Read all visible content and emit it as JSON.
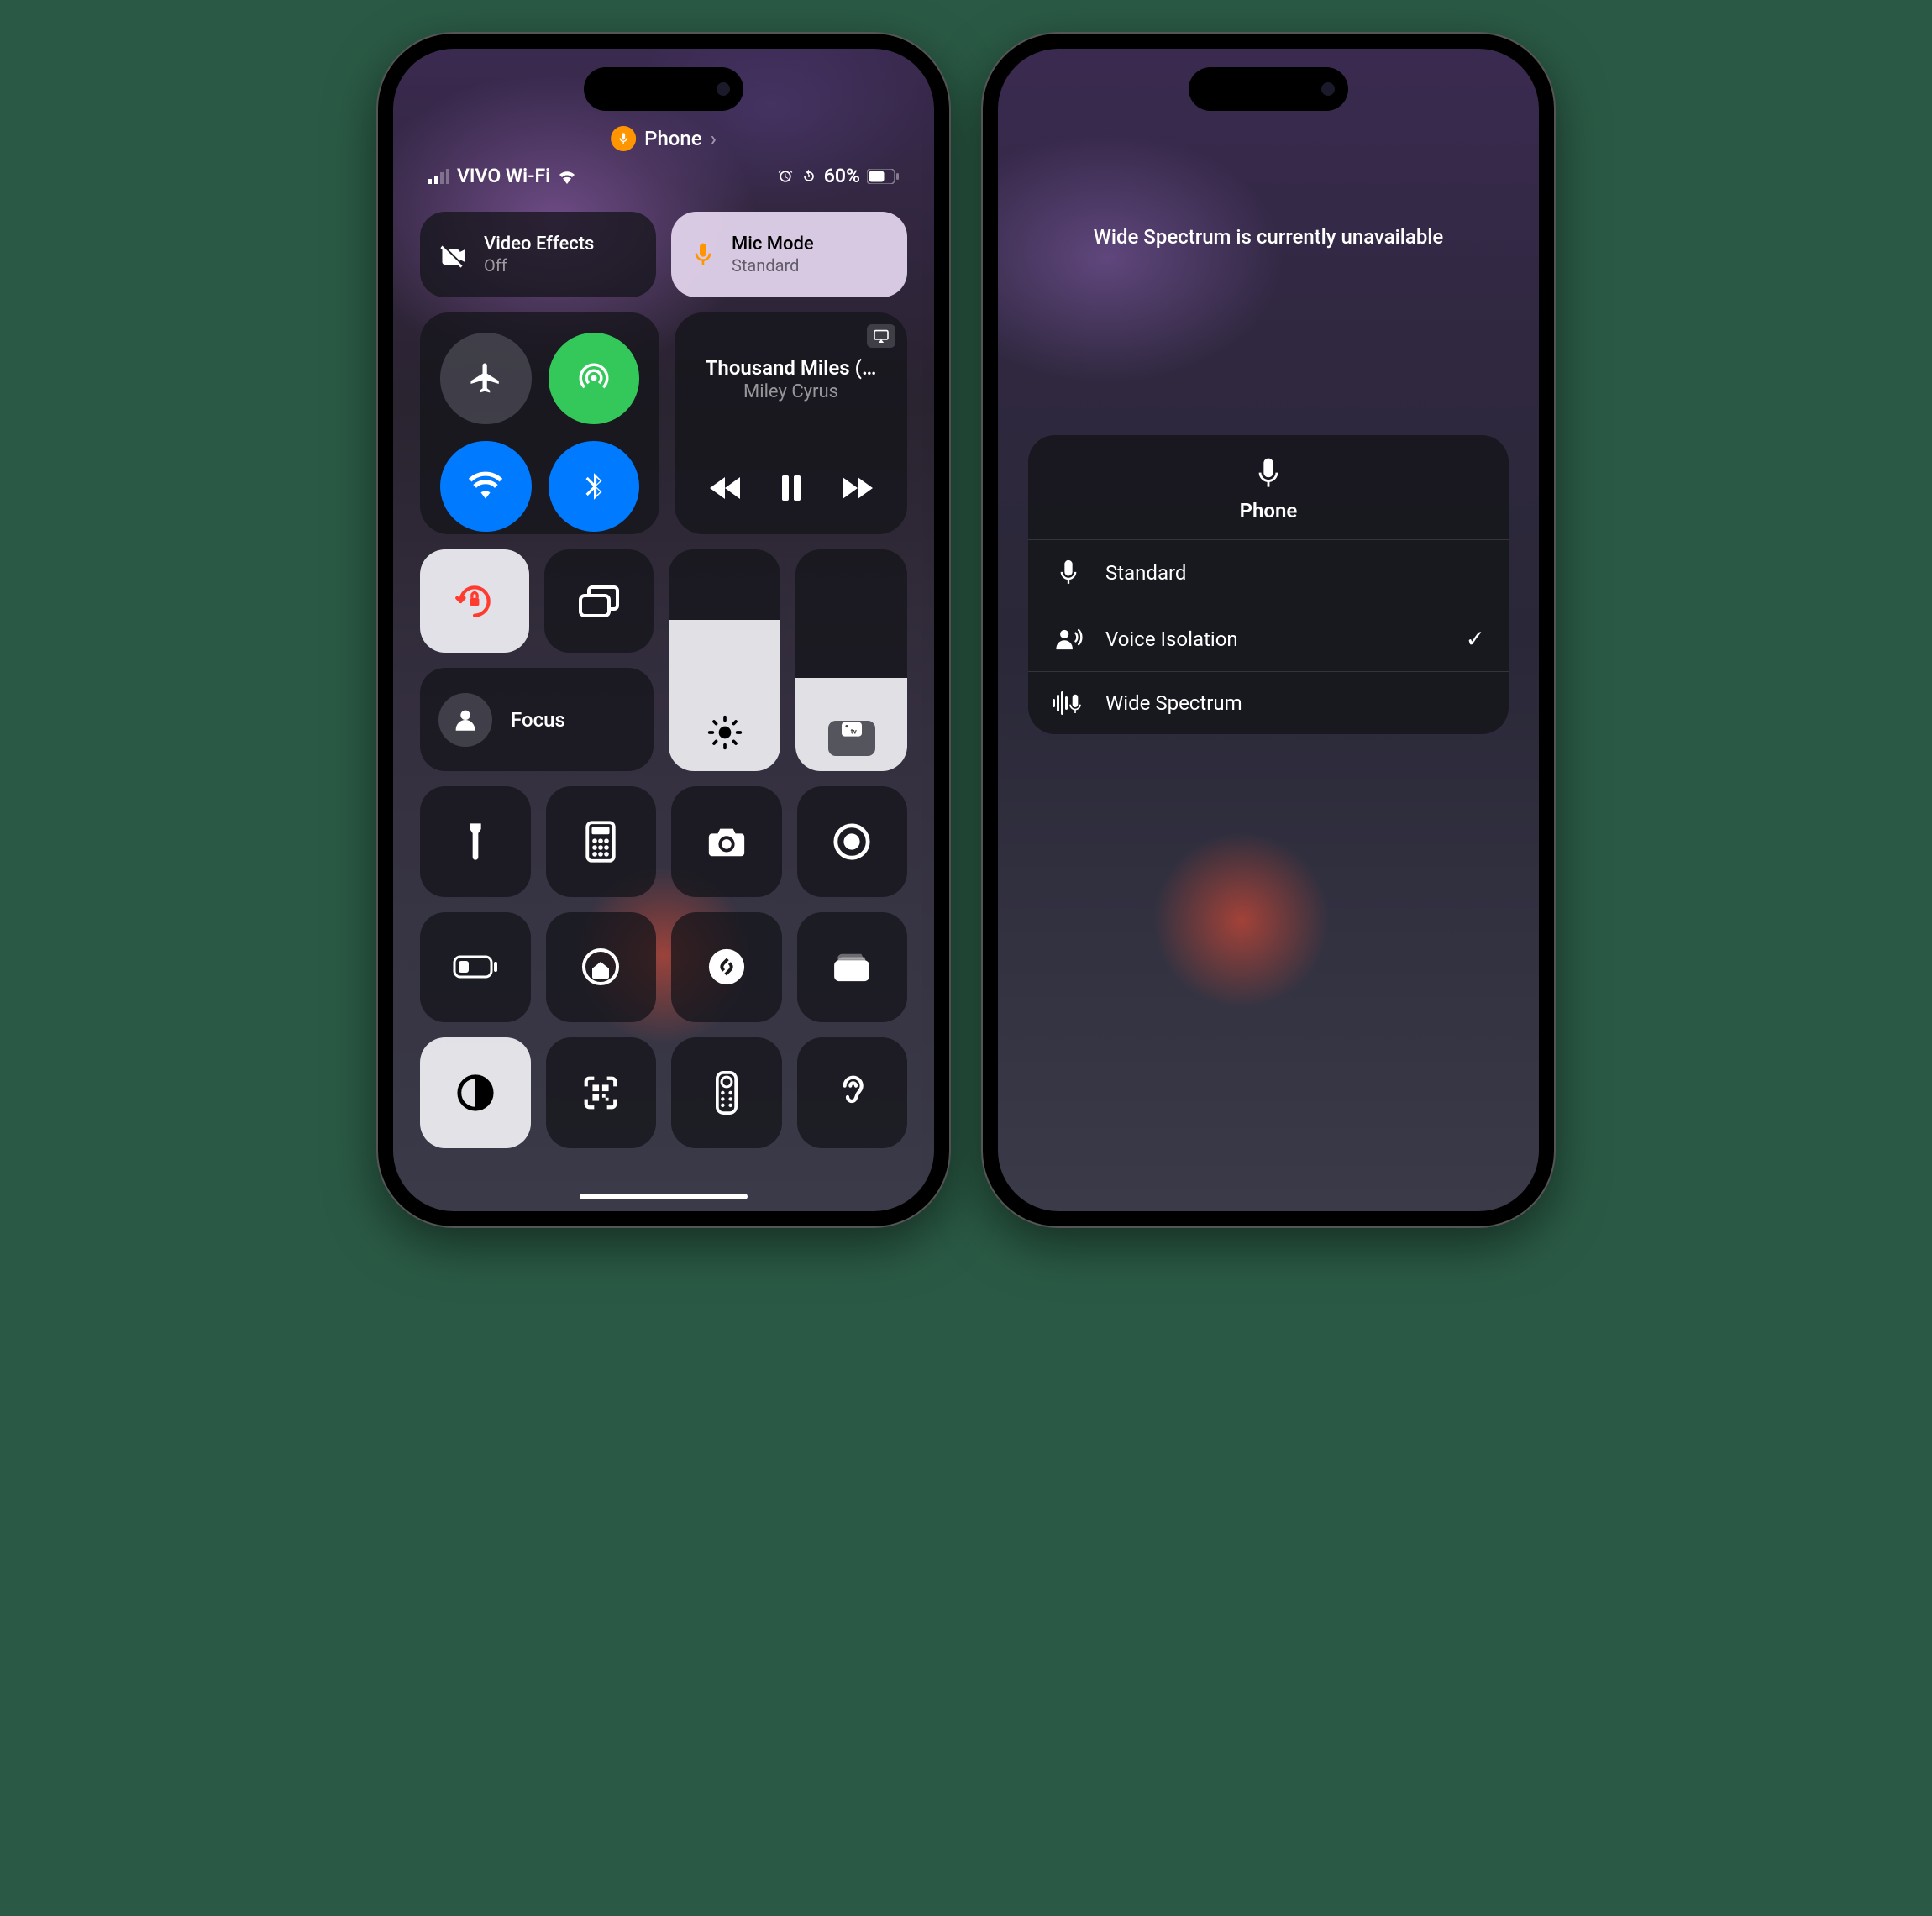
{
  "header": {
    "app_label": "Phone"
  },
  "status": {
    "carrier": "VIVO Wi-Fi",
    "battery_pct": "60%"
  },
  "tiles": {
    "video_effects": {
      "title": "Video Effects",
      "sub": "Off"
    },
    "mic_mode": {
      "title": "Mic Mode",
      "sub": "Standard"
    },
    "focus_label": "Focus"
  },
  "music": {
    "title": "Thousand Miles (…",
    "artist": "Miley Cyrus"
  },
  "brightness_pct": 68,
  "volume_pct": 42,
  "right": {
    "notice": "Wide Spectrum is currently unavailable",
    "panel_app": "Phone",
    "modes": {
      "standard": "Standard",
      "voice_isolation": "Voice Isolation",
      "wide_spectrum": "Wide Spectrum"
    },
    "selected": "voice_isolation"
  }
}
